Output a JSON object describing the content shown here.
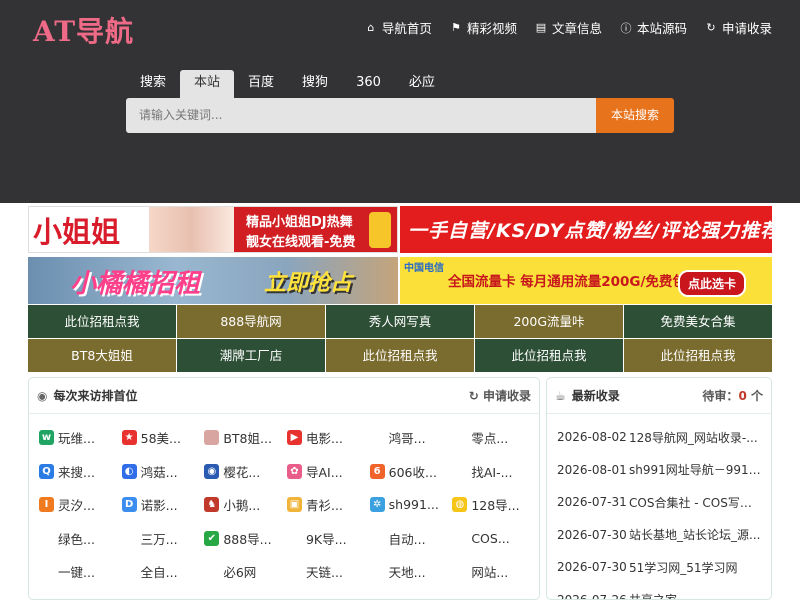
{
  "header": {
    "logo": "AT导航",
    "nav": [
      {
        "icon": "home-icon",
        "glyph": "⌂",
        "label": "导航首页"
      },
      {
        "icon": "flag-icon",
        "glyph": "⚑",
        "label": "精彩视频"
      },
      {
        "icon": "book-icon",
        "glyph": "▤",
        "label": "文章信息"
      },
      {
        "icon": "info-icon",
        "glyph": "ⓘ",
        "label": "本站源码"
      },
      {
        "icon": "refresh-icon",
        "glyph": "↻",
        "label": "申请收录"
      }
    ]
  },
  "search": {
    "tabs": [
      "搜索",
      "本站",
      "百度",
      "搜狗",
      "360",
      "必应"
    ],
    "active_tab": "本站",
    "placeholder": "请输入关键词...",
    "button": "本站搜索",
    "accent": "#e8731d"
  },
  "banners": {
    "b1": {
      "big": "小姐姐",
      "line1": "精品小姐姐DJ热舞",
      "line2": "靓女在线观看-免费"
    },
    "b2": {
      "text": "一手自营/KS/DY点赞/粉丝/评论强力推荐"
    },
    "b3": {
      "text": "小橘橘招租",
      "text2": "立即抢占"
    },
    "b4": {
      "brand": "中国电信",
      "text": "全国流量卡 每月通用流量200G/免费包邮",
      "button": "点此选卡"
    }
  },
  "links": [
    {
      "label": "此位招租点我",
      "color": "#2d4f36"
    },
    {
      "label": "888导航网",
      "color": "#7a6b2e"
    },
    {
      "label": "秀人网写真",
      "color": "#2d4f36"
    },
    {
      "label": "200G流量咔",
      "color": "#7a6b2e"
    },
    {
      "label": "免费美女合集",
      "color": "#2d4f36"
    },
    {
      "label": "BT8大姐姐",
      "color": "#7a6b2e"
    },
    {
      "label": "潮牌工厂店",
      "color": "#2d4f36"
    },
    {
      "label": "此位招租点我",
      "color": "#7a6b2e"
    },
    {
      "label": "此位招租点我",
      "color": "#2d4f36"
    },
    {
      "label": "此位招租点我",
      "color": "#7a6b2e"
    }
  ],
  "visitors": {
    "title": "每次来访排首位",
    "apply": "申请收录",
    "sites": [
      {
        "label": "玩维...",
        "icon": "w",
        "color": "#1fa463"
      },
      {
        "label": "58美...",
        "icon": "★",
        "color": "#e8322f"
      },
      {
        "label": "BT8姐...",
        "icon": "",
        "color": "#d9a5a0"
      },
      {
        "label": "电影...",
        "icon": "▶",
        "color": "#e8322f"
      },
      {
        "label": "鸿哥...",
        "icon": "",
        "color": ""
      },
      {
        "label": "零点...",
        "icon": "",
        "color": ""
      },
      {
        "label": "来搜...",
        "icon": "Q",
        "color": "#2b7be4"
      },
      {
        "label": "鸿菇...",
        "icon": "◐",
        "color": "#2f6ee8"
      },
      {
        "label": "樱花...",
        "icon": "◉",
        "color": "#2a5bb0"
      },
      {
        "label": "导AI...",
        "icon": "✿",
        "color": "#e85d8a"
      },
      {
        "label": "606收...",
        "icon": "6",
        "color": "#f0632a"
      },
      {
        "label": "找AI-...",
        "icon": "",
        "color": ""
      },
      {
        "label": "灵汐...",
        "icon": "I",
        "color": "#f07a20"
      },
      {
        "label": "诺影...",
        "icon": "D",
        "color": "#3b8df0"
      },
      {
        "label": "小鹅...",
        "icon": "♞",
        "color": "#c0392b"
      },
      {
        "label": "青衫...",
        "icon": "▣",
        "color": "#f0b43a"
      },
      {
        "label": "sh991...",
        "icon": "✲",
        "color": "#3aa0e0"
      },
      {
        "label": "128导...",
        "icon": "◍",
        "color": "#f5c518"
      },
      {
        "label": "绿色...",
        "icon": "",
        "color": ""
      },
      {
        "label": "三万...",
        "icon": "",
        "color": ""
      },
      {
        "label": "888导...",
        "icon": "✔",
        "color": "#28a745"
      },
      {
        "label": "9K导...",
        "icon": "",
        "color": ""
      },
      {
        "label": "自动...",
        "icon": "",
        "color": ""
      },
      {
        "label": "COS...",
        "icon": "",
        "color": ""
      },
      {
        "label": "一键...",
        "icon": "",
        "color": ""
      },
      {
        "label": "全自...",
        "icon": "",
        "color": ""
      },
      {
        "label": "必6网",
        "icon": "",
        "color": ""
      },
      {
        "label": "天链...",
        "icon": "",
        "color": ""
      },
      {
        "label": "天地...",
        "icon": "",
        "color": ""
      },
      {
        "label": "网站...",
        "icon": "",
        "color": ""
      }
    ]
  },
  "latest": {
    "title": "最新收录",
    "pending_label": "待审：",
    "pending_count": "0",
    "pending_unit": "个",
    "items": [
      {
        "date": "2026-08-02",
        "title": "128导航网_网站收录-..."
      },
      {
        "date": "2026-08-01",
        "title": "sh991网址导航－991自..."
      },
      {
        "date": "2026-07-31",
        "title": "COS合集社 - COS写真..."
      },
      {
        "date": "2026-07-30",
        "title": "站长基地_站长论坛_源..."
      },
      {
        "date": "2026-07-30",
        "title": "51学习网_51学习网"
      },
      {
        "date": "2026-07-26",
        "title": "共享之家"
      }
    ]
  }
}
